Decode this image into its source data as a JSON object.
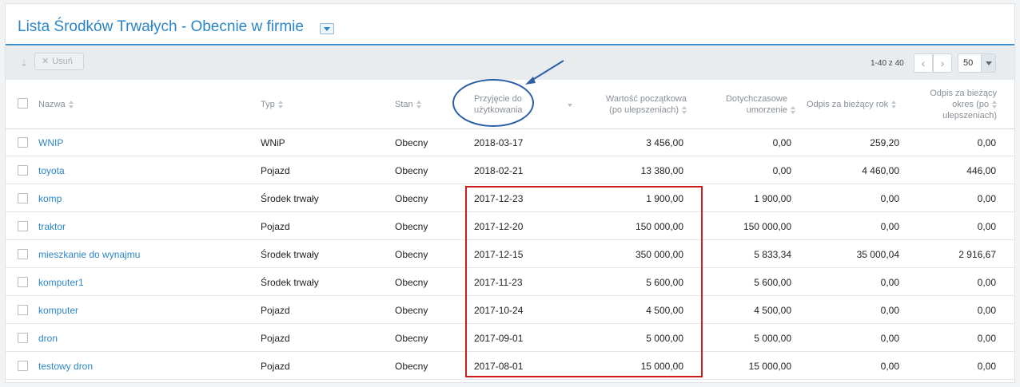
{
  "page": {
    "title": "Lista Środków Trwałych - Obecnie w firmie"
  },
  "toolbar": {
    "delete_label": "Usuń",
    "pager_range": "1-40 z 40",
    "page_size": "50"
  },
  "table": {
    "columns": [
      {
        "key": "name",
        "label": "Nazwa"
      },
      {
        "key": "type",
        "label": "Typ"
      },
      {
        "key": "state",
        "label": "Stan"
      },
      {
        "key": "date",
        "label_line1": "Przyjęcie do",
        "label_line2": "użytkowania"
      },
      {
        "key": "initial",
        "label_line1": "Wartość początkowa",
        "label_line2": "(po ulepszeniach)"
      },
      {
        "key": "dep",
        "label_line1": "Dotychczasowe",
        "label_line2": "umorzenie"
      },
      {
        "key": "year",
        "label": "Odpis za bieżący rok"
      },
      {
        "key": "period",
        "label_line1": "Odpis za bieżący",
        "label_line2": "okres (po",
        "label_line3": "ulepszeniach)"
      }
    ],
    "rows": [
      {
        "name": "WNIP",
        "type": "WNiP",
        "state": "Obecny",
        "date": "2018-03-17",
        "initial": "3 456,00",
        "dep": "0,00",
        "year": "259,20",
        "period": "0,00"
      },
      {
        "name": "toyota",
        "type": "Pojazd",
        "state": "Obecny",
        "date": "2018-02-21",
        "initial": "13 380,00",
        "dep": "0,00",
        "year": "4 460,00",
        "period": "446,00"
      },
      {
        "name": "komp",
        "type": "Środek trwały",
        "state": "Obecny",
        "date": "2017-12-23",
        "initial": "1 900,00",
        "dep": "1 900,00",
        "year": "0,00",
        "period": "0,00"
      },
      {
        "name": "traktor",
        "type": "Pojazd",
        "state": "Obecny",
        "date": "2017-12-20",
        "initial": "150 000,00",
        "dep": "150 000,00",
        "year": "0,00",
        "period": "0,00"
      },
      {
        "name": "mieszkanie do wynajmu",
        "type": "Środek trwały",
        "state": "Obecny",
        "date": "2017-12-15",
        "initial": "350 000,00",
        "dep": "5 833,34",
        "year": "35 000,04",
        "period": "2 916,67"
      },
      {
        "name": "komputer1",
        "type": "Środek trwały",
        "state": "Obecny",
        "date": "2017-11-23",
        "initial": "5 600,00",
        "dep": "5 600,00",
        "year": "0,00",
        "period": "0,00"
      },
      {
        "name": "komputer",
        "type": "Pojazd",
        "state": "Obecny",
        "date": "2017-10-24",
        "initial": "4 500,00",
        "dep": "4 500,00",
        "year": "0,00",
        "period": "0,00"
      },
      {
        "name": "dron",
        "type": "Pojazd",
        "state": "Obecny",
        "date": "2017-09-01",
        "initial": "5 000,00",
        "dep": "5 000,00",
        "year": "0,00",
        "period": "0,00"
      },
      {
        "name": "testowy dron",
        "type": "Pojazd",
        "state": "Obecny",
        "date": "2017-08-01",
        "initial": "15 000,00",
        "dep": "15 000,00",
        "year": "0,00",
        "period": "0,00"
      }
    ]
  },
  "colors": {
    "accent": "#2b86c9",
    "annotation_box": "#cf1d1d",
    "annotation_ellipse": "#2a5fa8"
  }
}
